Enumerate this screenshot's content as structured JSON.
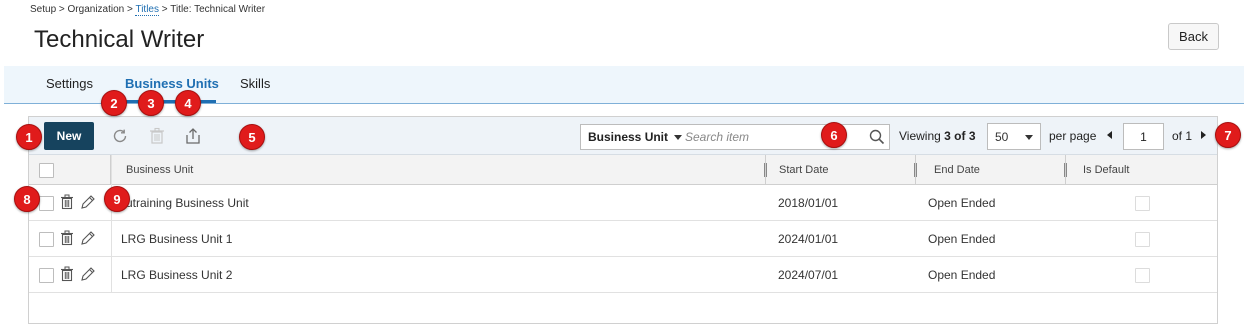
{
  "breadcrumb": {
    "part1": "Setup > Organization >",
    "link": "Titles",
    "part2": "> Title: Technical Writer"
  },
  "page_title": "Technical Writer",
  "back_label": "Back",
  "tabs": [
    {
      "label": "Settings"
    },
    {
      "label": "Business Units"
    },
    {
      "label": "Skills"
    }
  ],
  "toolbar": {
    "new_label": "New",
    "search_scope": "Business Unit",
    "search_placeholder": "Search item",
    "viewing_label": "Viewing",
    "viewing_count": "3 of 3",
    "per_page_value": "50",
    "per_page_label": "per page",
    "page_value": "1",
    "of_label": "of 1"
  },
  "table": {
    "columns": [
      "Business Unit",
      "Start Date",
      "End Date",
      "Is Default"
    ],
    "rows": [
      {
        "business_unit": "utraining Business Unit",
        "start_date": "2018/01/01",
        "end_date": "Open Ended"
      },
      {
        "business_unit": "LRG Business Unit 1",
        "start_date": "2024/01/01",
        "end_date": "Open Ended"
      },
      {
        "business_unit": "LRG Business Unit 2",
        "start_date": "2024/07/01",
        "end_date": "Open Ended"
      }
    ]
  },
  "callouts": [
    "1",
    "2",
    "3",
    "4",
    "5",
    "6",
    "7",
    "8",
    "9"
  ],
  "colors": {
    "accent": "#1f6fb2",
    "new_button": "#16435e",
    "callout": "#e01b1b"
  }
}
